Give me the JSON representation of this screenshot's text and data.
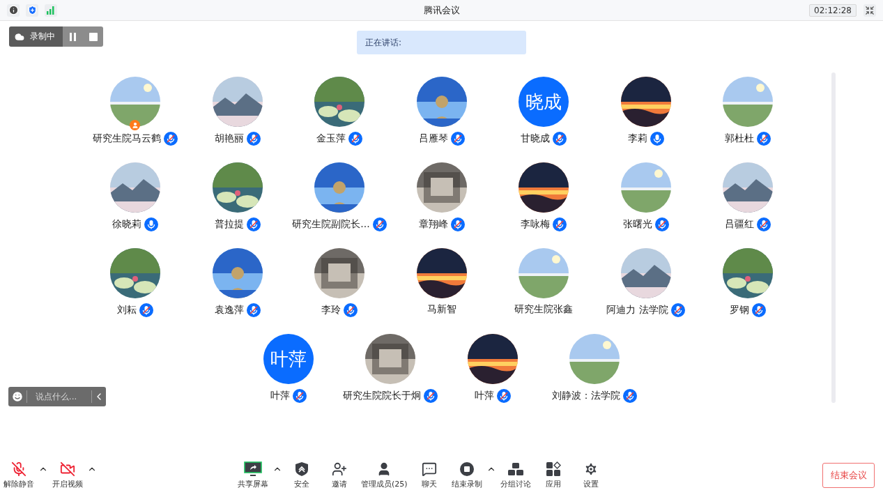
{
  "title_bar": {
    "title": "腾讯会议",
    "time": "02:12:28"
  },
  "recording": {
    "label": "录制中"
  },
  "speaking": {
    "label": "正在讲话:"
  },
  "participants": [
    {
      "name": "研究生院马云鹤",
      "muted": true,
      "host": true
    },
    {
      "name": "胡艳丽",
      "muted": true,
      "host": false
    },
    {
      "name": "金玉萍",
      "muted": true,
      "host": false
    },
    {
      "name": "吕雁琴",
      "muted": true,
      "host": false
    },
    {
      "name": "甘晓成",
      "avatar": {
        "kind": "initials",
        "text": "晓成"
      },
      "muted": true,
      "host": false
    },
    {
      "name": "李莉",
      "muted": false,
      "host": false
    },
    {
      "name": "郭杜杜",
      "muted": true,
      "host": false
    },
    {
      "name": "徐晓莉",
      "muted": false,
      "host": false
    },
    {
      "name": "普拉提",
      "muted": true,
      "host": false
    },
    {
      "name": "研究生院副院长...",
      "muted": true,
      "host": false
    },
    {
      "name": "章翔峰",
      "muted": true,
      "host": false
    },
    {
      "name": "李咏梅",
      "muted": true,
      "host": false
    },
    {
      "name": "张曙光",
      "muted": true,
      "host": false
    },
    {
      "name": "吕疆红",
      "muted": true,
      "host": false
    },
    {
      "name": "刘耘",
      "muted": true,
      "host": false
    },
    {
      "name": "袁逸萍",
      "muted": true,
      "host": false
    },
    {
      "name": "李玲",
      "muted": true,
      "host": false
    },
    {
      "name": "马新智",
      "host": false
    },
    {
      "name": "研究生院张鑫",
      "host": false
    },
    {
      "name": "阿迪力 法学院",
      "muted": true,
      "host": false
    },
    {
      "name": "罗钢",
      "muted": true,
      "host": false
    },
    {
      "name": "叶萍",
      "avatar": {
        "kind": "initials",
        "text": "叶萍"
      },
      "muted": true,
      "host": false
    },
    {
      "name": "研究生院院长于炯",
      "muted": true,
      "host": false
    },
    {
      "name": "叶萍",
      "muted": true,
      "host": false
    },
    {
      "name": "刘静波：法学院",
      "muted": true,
      "host": false
    }
  ],
  "chat": {
    "placeholder": "说点什么..."
  },
  "toolbar": {
    "left": [
      {
        "kind": "mic",
        "label": "解除静音",
        "menu": true
      },
      {
        "kind": "video",
        "label": "开启视频",
        "menu": true
      }
    ],
    "center": [
      {
        "kind": "share",
        "label": "共享屏幕",
        "menu": true
      },
      {
        "kind": "security",
        "label": "安全",
        "menu": false
      },
      {
        "kind": "invite",
        "label": "邀请",
        "menu": false
      },
      {
        "kind": "members",
        "label": "管理成员(25)",
        "menu": false
      },
      {
        "kind": "chat",
        "label": "聊天",
        "menu": false
      },
      {
        "kind": "record",
        "label": "结束录制",
        "menu": true
      },
      {
        "kind": "breakout",
        "label": "分组讨论",
        "menu": false
      },
      {
        "kind": "apps",
        "label": "应用",
        "menu": false
      },
      {
        "kind": "settings",
        "label": "设置",
        "menu": false
      }
    ]
  },
  "end_button": "结束会议"
}
